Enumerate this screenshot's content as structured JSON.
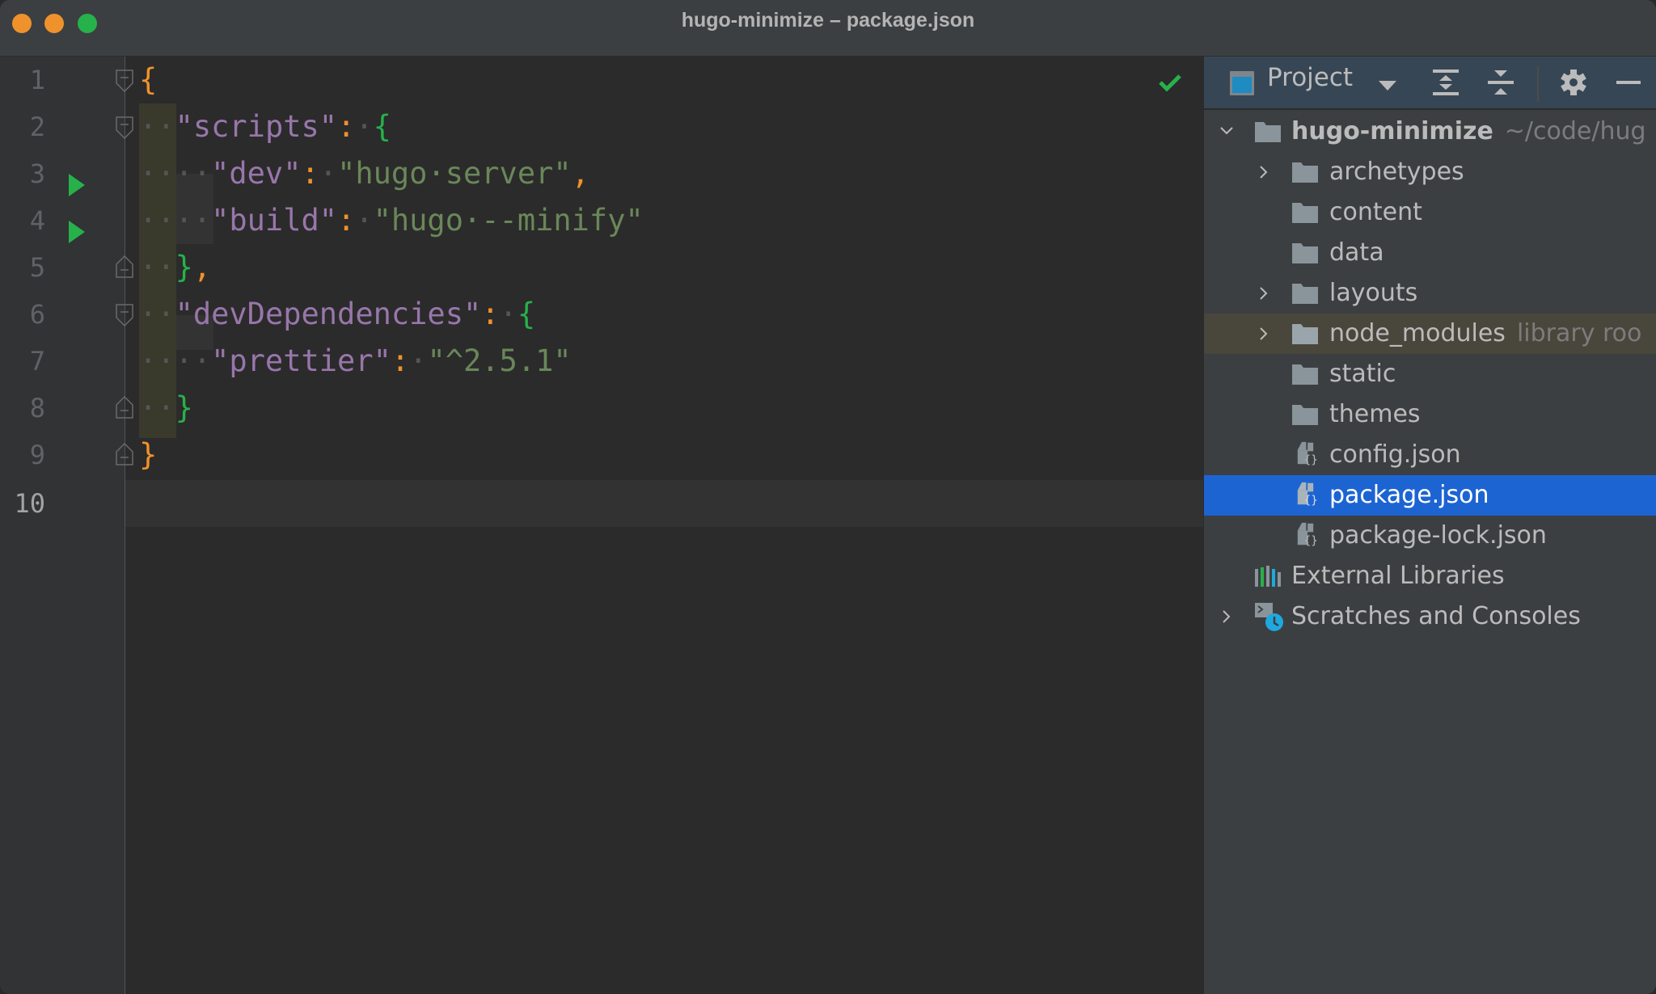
{
  "window": {
    "title": "hugo-minimize – package.json"
  },
  "editor": {
    "file_status": "no-problems",
    "current_line": 10,
    "lines": [
      {
        "num": "1",
        "run": false,
        "fold": "open"
      },
      {
        "num": "2",
        "run": false,
        "fold": "open"
      },
      {
        "num": "3",
        "run": true,
        "fold": null
      },
      {
        "num": "4",
        "run": true,
        "fold": null
      },
      {
        "num": "5",
        "run": false,
        "fold": "close"
      },
      {
        "num": "6",
        "run": false,
        "fold": "open"
      },
      {
        "num": "7",
        "run": false,
        "fold": null
      },
      {
        "num": "8",
        "run": false,
        "fold": "close"
      },
      {
        "num": "9",
        "run": false,
        "fold": "close"
      },
      {
        "num": "10",
        "run": false,
        "fold": null
      }
    ],
    "code": {
      "l1": {
        "brace": "{"
      },
      "l2": {
        "indent": "··",
        "key": "\"scripts\"",
        "colon": ":",
        "sp": "·",
        "brace": "{"
      },
      "l3": {
        "indent": "····",
        "key": "\"dev\"",
        "colon": ":",
        "sp": "·",
        "value": "\"hugo·server\"",
        "comma": ","
      },
      "l4": {
        "indent": "····",
        "key": "\"build\"",
        "colon": ":",
        "sp": "·",
        "value": "\"hugo·--minify\""
      },
      "l5": {
        "indent": "··",
        "brace": "}",
        "comma": ","
      },
      "l6": {
        "indent": "··",
        "key": "\"devDependencies\"",
        "colon": ":",
        "sp": "·",
        "brace": "{"
      },
      "l7": {
        "indent": "····",
        "key": "\"prettier\"",
        "colon": ":",
        "sp": "·",
        "value": "\"^2.5.1\""
      },
      "l8": {
        "indent": "··",
        "brace": "}"
      },
      "l9": {
        "brace": "}"
      }
    }
  },
  "project_panel": {
    "title": "Project",
    "icons": [
      "expand-all-icon",
      "collapse-all-icon",
      "gear-icon",
      "hide-icon"
    ],
    "tree": [
      {
        "label": "hugo-minimize",
        "hint": "~/code/hugo-minimize",
        "hint_visible": "~/code/hug",
        "type": "project-folder",
        "expanded": true,
        "level": 0
      },
      {
        "label": "archetypes",
        "type": "folder",
        "expandable": true,
        "level": 1
      },
      {
        "label": "content",
        "type": "folder",
        "expandable": false,
        "level": 1
      },
      {
        "label": "data",
        "type": "folder",
        "expandable": false,
        "level": 1
      },
      {
        "label": "layouts",
        "type": "folder",
        "expandable": true,
        "level": 1
      },
      {
        "label": "node_modules",
        "hint": "library roo",
        "type": "folder",
        "expandable": true,
        "level": 1,
        "excluded": true
      },
      {
        "label": "static",
        "type": "folder",
        "expandable": false,
        "level": 1
      },
      {
        "label": "themes",
        "type": "folder",
        "expandable": false,
        "level": 1
      },
      {
        "label": "config.json",
        "type": "json-file",
        "level": 1
      },
      {
        "label": "package.json",
        "type": "json-file",
        "level": 1,
        "selected": true
      },
      {
        "label": "package-lock.json",
        "type": "json-file",
        "level": 1
      },
      {
        "label": "External Libraries",
        "type": "libraries",
        "level": 0
      },
      {
        "label": "Scratches and Consoles",
        "type": "scratches",
        "expandable": true,
        "level": 0
      }
    ]
  },
  "colors": {
    "selection": "#1d64d3",
    "run_green": "#27b14a",
    "brace_orange": "#f0922c",
    "key_purple": "#9876aa",
    "string_green": "#6a8759"
  }
}
